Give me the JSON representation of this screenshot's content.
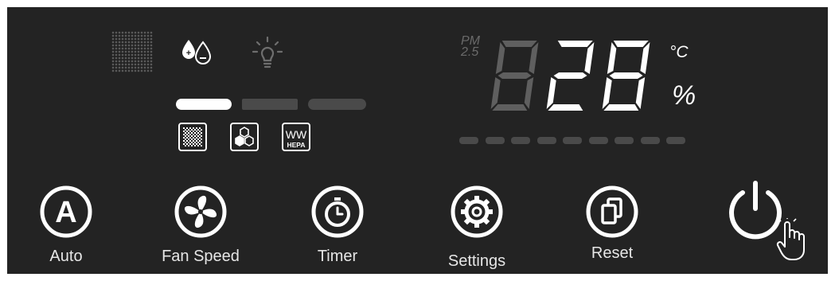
{
  "indicators": {
    "dot_matrix_icon": "dot-matrix-icon",
    "humidity_icon": "humidity-plus-minus-icon",
    "light_icon": "light-bulb-icon"
  },
  "filter_level": {
    "segments_total": 3,
    "segments_active": 1
  },
  "filters": [
    {
      "name": "pre-filter-icon"
    },
    {
      "name": "carbon-filter-icon"
    },
    {
      "name": "hepa-filter-icon",
      "text_top": "WW",
      "text_bottom": "HEPA"
    }
  ],
  "display": {
    "pm_label_top": "PM",
    "pm_label_bottom": "2.5",
    "digits": [
      "8",
      "2",
      "8"
    ],
    "digits_lit": [
      false,
      true,
      true
    ],
    "unit_celsius": "°C",
    "unit_percent": "%",
    "progress_dashes_total": 9,
    "progress_dashes_active": 0
  },
  "buttons": [
    {
      "id": "auto",
      "label": "Auto",
      "icon": "auto-a-icon"
    },
    {
      "id": "fan-speed",
      "label": "Fan Speed",
      "icon": "fan-icon"
    },
    {
      "id": "timer",
      "label": "Timer",
      "icon": "stopwatch-icon"
    },
    {
      "id": "settings",
      "label": "Settings",
      "icon": "gear-icon"
    },
    {
      "id": "reset",
      "label": "Reset",
      "icon": "copy-pages-icon"
    },
    {
      "id": "power",
      "label": "",
      "icon": "power-icon"
    }
  ],
  "colors": {
    "panel": "#232323",
    "lit": "#ffffff",
    "dim": "#5f5f5f",
    "bar_inactive": "#4a4a4a"
  }
}
